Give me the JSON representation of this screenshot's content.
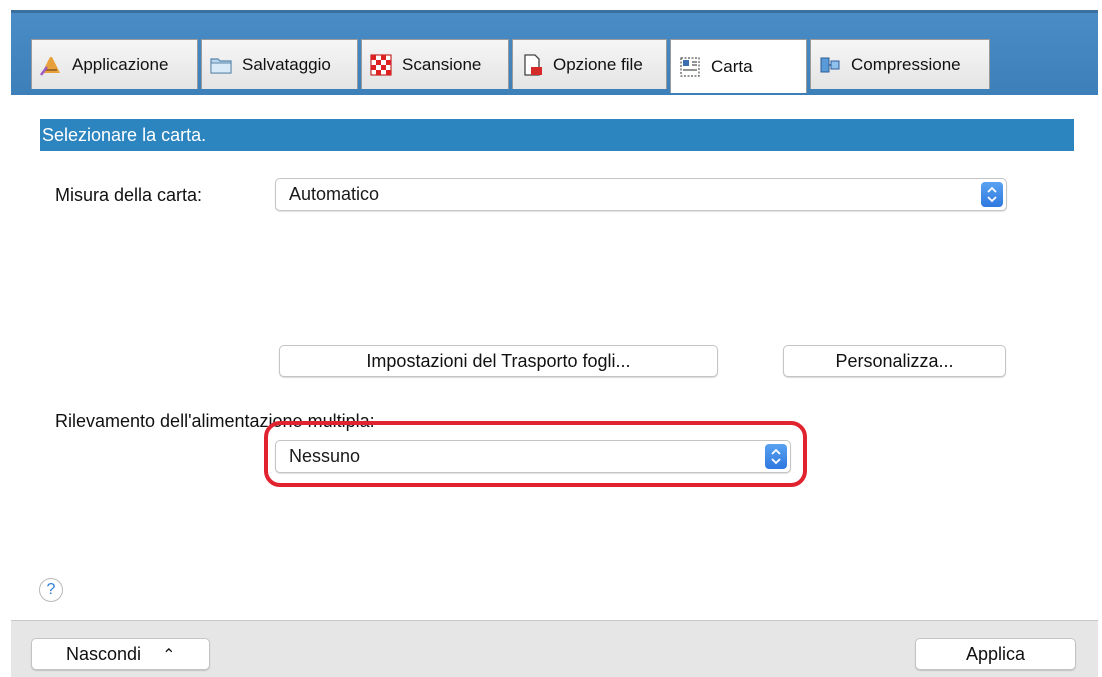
{
  "tabs": [
    {
      "label": "Applicazione",
      "icon": "applicazione-icon"
    },
    {
      "label": "Salvataggio",
      "icon": "folder-icon"
    },
    {
      "label": "Scansione",
      "icon": "scansione-icon"
    },
    {
      "label": "Opzione file",
      "icon": "file-icon"
    },
    {
      "label": "Carta",
      "icon": "paper-icon",
      "active": true
    },
    {
      "label": "Compressione",
      "icon": "compressione-icon"
    }
  ],
  "banner": {
    "text": "Selezionare la carta."
  },
  "paper_size": {
    "label": "Misura della carta:",
    "value": "Automatico"
  },
  "buttons": {
    "transport": "Impostazioni del Trasporto fogli...",
    "customize": "Personalizza..."
  },
  "multifeed": {
    "label": "Rilevamento dell'alimentazione multipla:",
    "value": "Nessuno"
  },
  "help": {
    "glyph": "?"
  },
  "footer": {
    "hide_label": "Nascondi",
    "hide_chevron": "⌃",
    "apply_label": "Applica"
  },
  "colors": {
    "banner": "#2d85c0",
    "tabbar": "#4a8cc6",
    "highlight": "#e0232e",
    "stepper": "#2f78e0"
  }
}
